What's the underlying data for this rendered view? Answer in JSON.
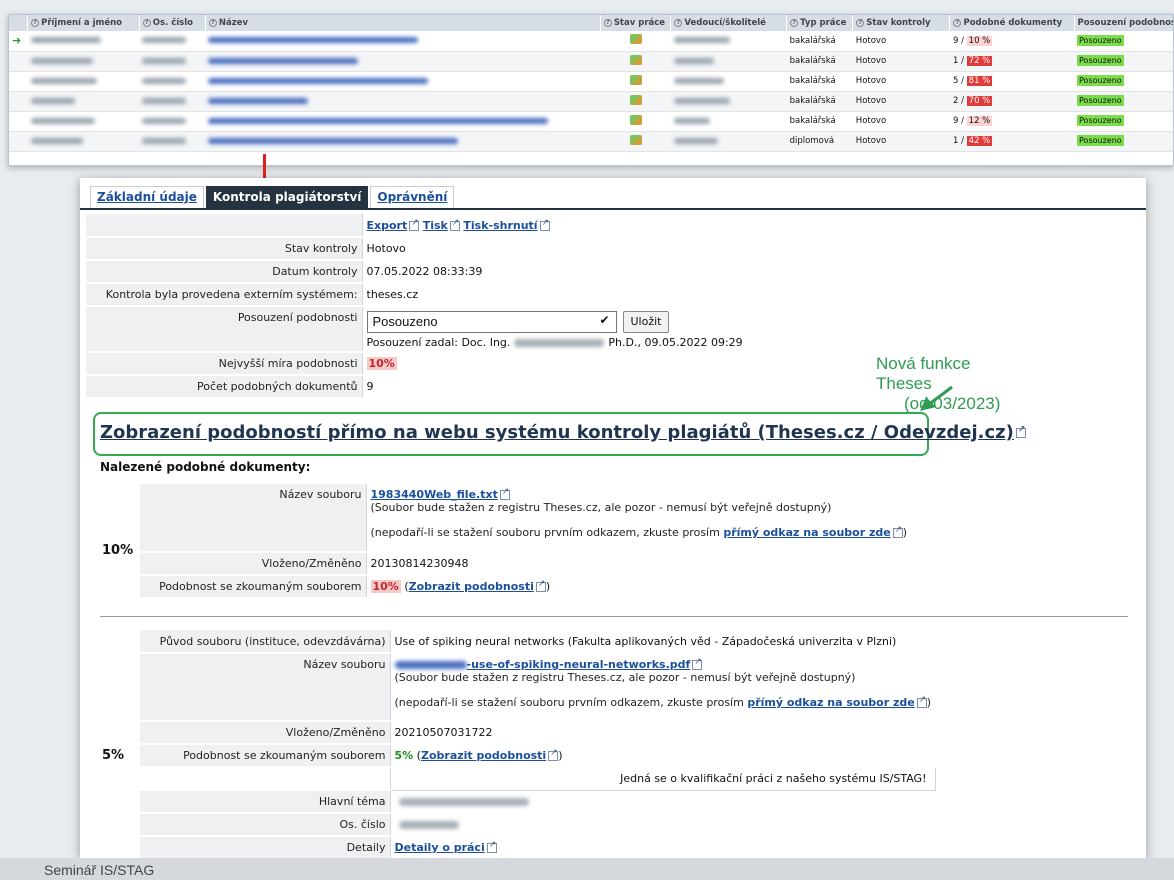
{
  "top_table": {
    "headers": [
      "Příjmení a jméno",
      "Os. číslo",
      "Název",
      "Stav práce",
      "Vedoucí/školitelé",
      "Typ práce",
      "Stav kontroly",
      "Podobné dokumenty",
      "Posouzení podobnost"
    ],
    "rows": [
      {
        "type": "bakalářská",
        "status": "Hotovo",
        "count": "9 /",
        "pct": "10 %",
        "level": "lo",
        "assessment": "Posouzeno",
        "current": true
      },
      {
        "type": "bakalářská",
        "status": "Hotovo",
        "count": "1 /",
        "pct": "72 %",
        "level": "hi",
        "assessment": "Posouzeno",
        "current": false
      },
      {
        "type": "bakalářská",
        "status": "Hotovo",
        "count": "5 /",
        "pct": "81 %",
        "level": "hi",
        "assessment": "Posouzeno",
        "current": false
      },
      {
        "type": "bakalářská",
        "status": "Hotovo",
        "count": "2 /",
        "pct": "70 %",
        "level": "hi",
        "assessment": "Posouzeno",
        "current": false
      },
      {
        "type": "bakalářská",
        "status": "Hotovo",
        "count": "9 /",
        "pct": "12 %",
        "level": "lo",
        "assessment": "Posouzeno",
        "current": false
      },
      {
        "type": "diplomová",
        "status": "Hotovo",
        "count": "1 /",
        "pct": "42 %",
        "level": "hi",
        "assessment": "Posouzeno",
        "current": false
      }
    ]
  },
  "tabs": {
    "basic": "Základní údaje",
    "plagiarism": "Kontrola plagiátorství",
    "permissions": "Oprávnění"
  },
  "actions": {
    "export": "Export",
    "print": "Tisk",
    "print_summary": "Tisk-shrnutí"
  },
  "check": {
    "state_label": "Stav kontroly",
    "state_value": "Hotovo",
    "date_label": "Datum kontroly",
    "date_value": "07.05.2022 08:33:39",
    "external_label": "Kontrola byla provedena externím systémem:",
    "external_value": "theses.cz",
    "assessment_label": "Posouzení podobnosti",
    "assessment_selected": "Posouzeno",
    "save_label": "Uložit",
    "assessed_by_prefix": "Posouzení zadal: Doc. Ing.",
    "assessed_by_suffix": "Ph.D., 09.05.2022 09:29",
    "max_similarity_label": "Nejvyšší míra podobnosti",
    "max_similarity_value": "10%",
    "similar_count_label": "Počet podobných dokumentů",
    "similar_count_value": "9"
  },
  "theses_link": "Zobrazení podobností přímo na webu systému kontroly plagiátů (Theses.cz / Odevzdej.cz)",
  "annotation": {
    "line1": "Nová funkce",
    "line2": "Theses",
    "line3": "(od 03/2023)"
  },
  "found_title": "Nalezené podobné dokumenty:",
  "doc1": {
    "percent": "10%",
    "file_label": "Název souboru",
    "file_name": "1983440Web_file.txt",
    "note1": "(Soubor bude stažen z registru Theses.cz, ale pozor - nemusí být veřejně dostupný)",
    "note2_prefix": "(nepodaří-li se stažení souboru prvním odkazem, zkuste prosím",
    "direct_link": "přímý odkaz na soubor zde",
    "note2_suffix": ")",
    "inserted_label": "Vloženo/Změněno",
    "inserted_value": "20130814230948",
    "similarity_label": "Podobnost se zkoumaným souborem",
    "similarity_value": "10%",
    "show_similarity": "Zobrazit podobnosti"
  },
  "doc2": {
    "percent": "5%",
    "origin_label": "Původ souboru (instituce, odevzdávárna)",
    "origin_value": "Use of spiking neural networks (Fakulta aplikovaných věd - Západočeská univerzita v Plzni)",
    "file_label": "Název souboru",
    "file_name_suffix": "-use-of-spiking-neural-networks.pdf",
    "note1": "(Soubor bude stažen z registru Theses.cz, ale pozor - nemusí být veřejně dostupný)",
    "note2_prefix": "(nepodaří-li se stažení souboru prvním odkazem, zkuste prosím",
    "direct_link": "přímý odkaz na soubor zde",
    "note2_suffix": ")",
    "inserted_label": "Vloženo/Změněno",
    "inserted_value": "20210507031722",
    "similarity_label": "Podobnost se zkoumaným souborem",
    "similarity_value": "5%",
    "show_similarity": "Zobrazit podobnosti",
    "own_system_note": "Jedná se o kvalifikační práci z našeho systému IS/STAG!",
    "main_topic_label": "Hlavní téma",
    "os_number_label": "Os. číslo",
    "details_label": "Detaily",
    "details_link": "Detaily o práci"
  },
  "footer_text": "Seminář IS/STAG",
  "colors": {
    "tab_active": "#253341",
    "link": "#1b4f9c",
    "green_annotation": "#2f9b53",
    "red_arrow": "#e02020"
  }
}
